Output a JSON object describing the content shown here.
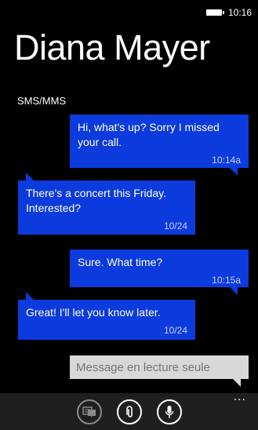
{
  "status_bar": {
    "time": "10:16",
    "battery_icon": "battery-icon"
  },
  "header": {
    "contact_name": "Diana Mayer",
    "channel": "SMS/MMS"
  },
  "messages": [
    {
      "direction": "sent",
      "text": "Hi, what's up? Sorry I missed\nyour call.",
      "time": "10:14a"
    },
    {
      "direction": "received",
      "text": "There's a concert this Friday.\nInterested?",
      "time": "10/24"
    },
    {
      "direction": "sent",
      "text": "Sure. What time?",
      "time": "10:15a"
    },
    {
      "direction": "received",
      "text": "Great! I'll let you know later.",
      "time": "10/24"
    }
  ],
  "compose": {
    "placeholder": "Message en lecture seule"
  },
  "app_bar": {
    "buttons": [
      {
        "icon": "switch-conversation-icon",
        "enabled": false
      },
      {
        "icon": "attach-icon",
        "enabled": true
      },
      {
        "icon": "microphone-icon",
        "enabled": true
      }
    ],
    "more_label": "..."
  },
  "colors": {
    "bubble": "#0b3bdc",
    "background": "#000000",
    "app_bar": "#1f1f1f",
    "compose": "#d8d8d8"
  }
}
